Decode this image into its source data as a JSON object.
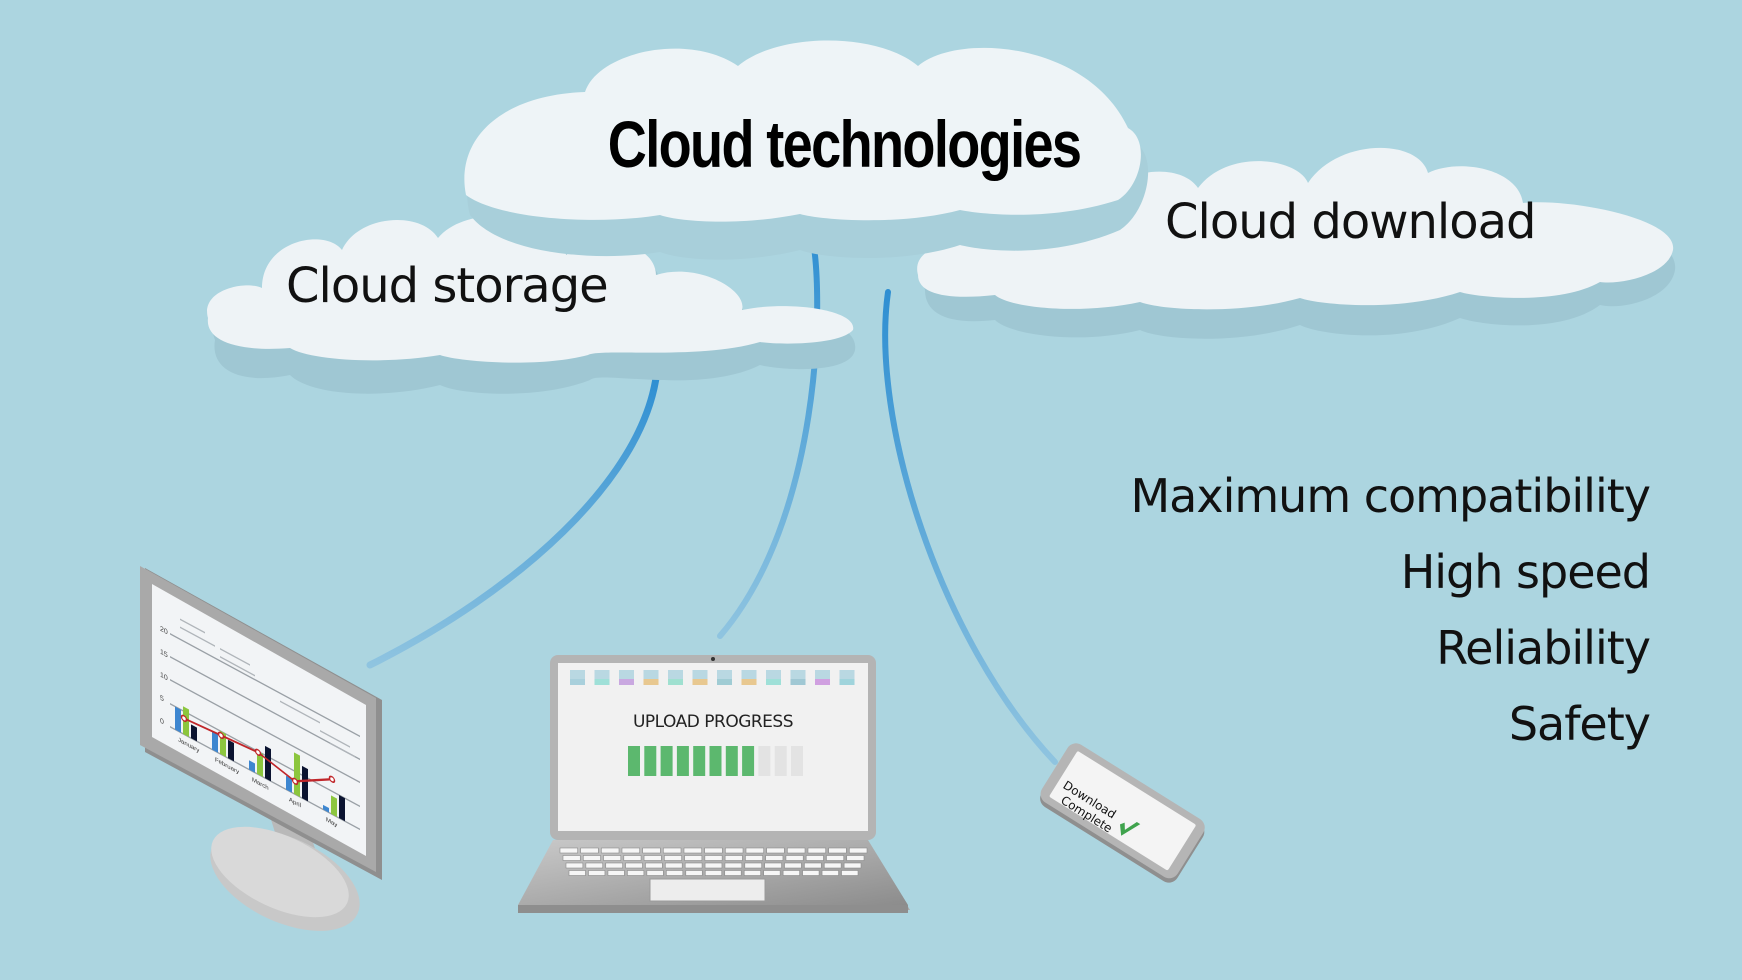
{
  "title": "Cloud technologies",
  "clouds": {
    "storage": "Cloud storage",
    "download": "Cloud download"
  },
  "features": [
    "Maximum compatibility",
    "High speed",
    "Reliability",
    "Safety"
  ],
  "devices": {
    "monitor": {
      "chart": {
        "y_ticks": [
          "20",
          "15",
          "10",
          "5",
          "0"
        ],
        "months": [
          "January",
          "February",
          "March",
          "April",
          "May"
        ]
      }
    },
    "laptop": {
      "label": "UPLOAD PROGRESS",
      "progress_filled": 8,
      "progress_total": 11
    },
    "phone": {
      "line1": "Download",
      "line2": "Complete"
    }
  },
  "colors": {
    "background": "#acd5e0",
    "cloud": "#eef3f6",
    "cloud_shadow": "#9fc7d3",
    "wire": "#3a9ad6",
    "progress_green": "#5cb86e",
    "bar_blue": "#3d86d0",
    "bar_green": "#8cc63e",
    "bar_navy": "#0b1330",
    "line_red": "#c0262a"
  }
}
